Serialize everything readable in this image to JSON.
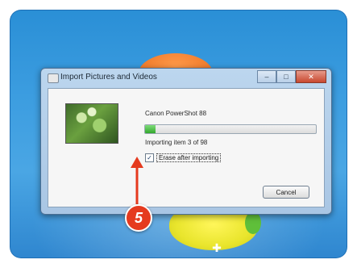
{
  "window": {
    "title": "Import Pictures and Videos",
    "caption_buttons": [
      "–",
      "□",
      "✕"
    ]
  },
  "import": {
    "device_name": "Canon PowerShot 88",
    "progress_fraction": 0.06,
    "status": "Importing item 3 of 98",
    "erase_checkbox": {
      "label": "Erase after importing",
      "checked": true,
      "check_glyph": "✓"
    },
    "cancel_label": "Cancel"
  },
  "callout": {
    "number": "5",
    "color": "#e53a1e"
  },
  "colors": {
    "desktop": "#3c9de0",
    "progress_fill": "#33a82d"
  }
}
